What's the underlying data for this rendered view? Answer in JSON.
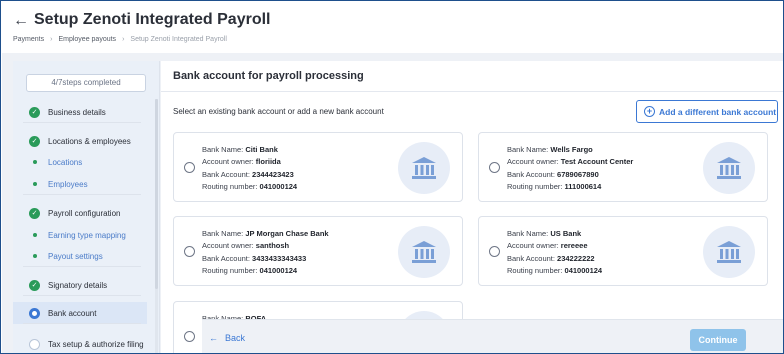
{
  "header": {
    "title": "Setup Zenoti Integrated Payroll",
    "breadcrumb": [
      "Payments",
      "Employee payouts",
      "Setup Zenoti Integrated Payroll"
    ]
  },
  "sidebar": {
    "steps_completed": "4/7steps completed",
    "items": [
      {
        "label": "Business details",
        "status": "done"
      },
      {
        "label": "Locations & employees",
        "status": "done"
      },
      {
        "label": "Locations",
        "status": "sub"
      },
      {
        "label": "Employees",
        "status": "sub"
      },
      {
        "label": "Payroll configuration",
        "status": "done"
      },
      {
        "label": "Earning type mapping",
        "status": "sub"
      },
      {
        "label": "Payout settings",
        "status": "sub"
      },
      {
        "label": "Signatory details",
        "status": "done"
      },
      {
        "label": "Bank account",
        "status": "active"
      },
      {
        "label": "Tax setup & authorize filing",
        "status": "pending"
      }
    ]
  },
  "main": {
    "title": "Bank account for payroll processing",
    "instruction": "Select an existing bank account or add a new bank account",
    "add_button": "Add a different bank account",
    "field_labels": {
      "name": "Bank Name:",
      "owner": "Account owner:",
      "account": "Bank Account:",
      "routing": "Routing number:"
    },
    "accounts": [
      {
        "bank_name": "Citi Bank",
        "owner": "floriida",
        "account": "2344423423",
        "routing": "041000124"
      },
      {
        "bank_name": "Wells Fargo",
        "owner": "Test Account Center",
        "account": "6789067890",
        "routing": "111000614"
      },
      {
        "bank_name": "JP Morgan Chase Bank",
        "owner": "santhosh",
        "account": "3433433343433",
        "routing": "041000124"
      },
      {
        "bank_name": "US Bank",
        "owner": "rereeee",
        "account": "234222222",
        "routing": "041000124"
      },
      {
        "bank_name": "BOFA",
        "owner": "",
        "account": "",
        "routing": ""
      }
    ]
  },
  "footer": {
    "back_label": "Back",
    "continue_label": "Continue"
  },
  "colors": {
    "accent": "#3b78d4",
    "success": "#2a9b5a",
    "continue_disabled": "#8fc3ea"
  }
}
